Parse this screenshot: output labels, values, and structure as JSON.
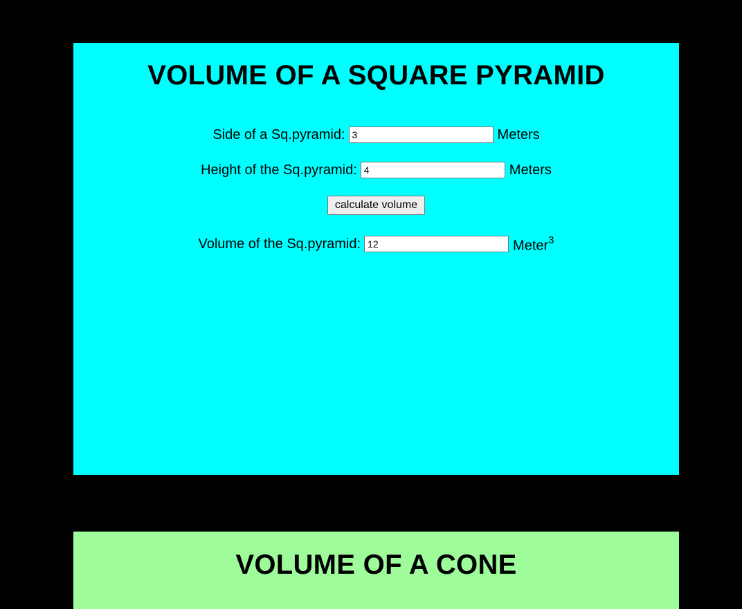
{
  "pyramid": {
    "title": "VOLUME OF A SQUARE PYRAMID",
    "side_label": "Side of a Sq.pyramid:",
    "side_value": "3",
    "side_unit": "Meters",
    "height_label": "Height of the Sq.pyramid:",
    "height_value": "4",
    "height_unit": "Meters",
    "button_label": "calculate volume",
    "volume_label": "Volume of the Sq.pyramid:",
    "volume_value": "12",
    "volume_unit": "Meter",
    "volume_unit_exponent": "3",
    "background": "#00ffff"
  },
  "cone": {
    "title": "VOLUME OF A CONE",
    "background": "#9ffc9a"
  },
  "page_background": "#000000"
}
